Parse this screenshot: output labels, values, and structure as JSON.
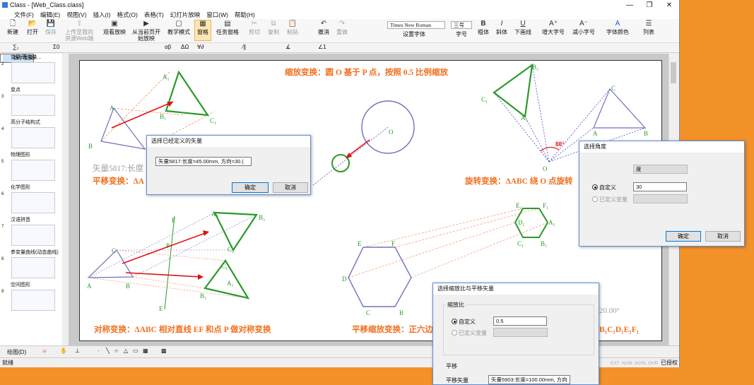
{
  "window": {
    "title": "Class - [Web_Class.class]",
    "controls": [
      "—",
      "❐",
      "✕"
    ]
  },
  "menu": [
    "文件(F)",
    "编辑(E)",
    "视图(V)",
    "插入(I)",
    "格式(O)",
    "表格(T)",
    "幻灯片放映",
    "窗口(W)",
    "帮助(H)"
  ],
  "ribbon": {
    "new": "新建",
    "open": "打开",
    "save": "保存",
    "upload_1": "上传至我的",
    "upload_2": "资源Web端",
    "watch_show": "观看放映",
    "from_page_1": "从当前页开",
    "from_page_2": "始放映",
    "teach_mode": "教学模式",
    "window_btn": "窗格",
    "task_pane": "任务窗格",
    "cut": "剪切",
    "copy": "复制",
    "paste": "粘贴",
    "undo": "撤消",
    "redo": "重做",
    "font_name": "Times New Roman",
    "font_size": "三号",
    "set_font": "设置字体",
    "size_label": "字号",
    "bold": "粗体",
    "italic": "斜体",
    "underline": "下画线",
    "grow_font": "增大字号",
    "shrink_font": "减小字号",
    "font_color": "字体颜色",
    "list": "列表"
  },
  "toolbar2": [
    "∑₁",
    "Σ0",
    "αβ",
    "ΔΩ",
    "∀∂",
    "∕∥",
    "∡",
    "∠1"
  ],
  "sidebar": [
    {
      "label": "数学变换",
      "num": "1"
    },
    {
      "label": "变量-真变量...",
      "num": "2"
    },
    {
      "label": "变点",
      "num": "3"
    },
    {
      "label": "高分子结构式",
      "num": "4"
    },
    {
      "label": "物理图形",
      "num": "5"
    },
    {
      "label": "化学图形",
      "num": "6"
    },
    {
      "label": "汉语拼音",
      "num": "7"
    },
    {
      "label": "参变量曲线(动态曲线)",
      "num": "8"
    },
    {
      "label": "空间图形",
      "num": "9"
    }
  ],
  "slide": {
    "scale_title": "缩放变换：圆 O 基于 P 点，按照 0.5 比例缩放",
    "vector_text": "矢量5817:长度",
    "translate_title": "平移变换：ΔA",
    "rotate_title": "旋转变换：ΔABC 绕 O 点旋转",
    "angle_label": "80°",
    "symmetry_title": "对称变换：ΔABC 相对直线 EF 和点 P 做对称变换",
    "transscale_title": "平移缩放变换：正六边",
    "transscale_tail": "B₁C₁D₁E₁F₁",
    "angle_tail": "20.00°",
    "labels": {
      "A": "A",
      "B": "B",
      "C": "C",
      "A1": "A₁",
      "B1": "B₁",
      "C1": "C₁",
      "A2": "A₂",
      "B2": "B₂",
      "C2": "C₂",
      "D": "D",
      "E": "E",
      "F": "F",
      "D1": "D₁",
      "E1": "E₁",
      "F1": "F₁",
      "O": "O",
      "P": "P"
    }
  },
  "dialog_vector": {
    "title": "选择已经定义的矢量",
    "selected": "矢量5817:长度=45.00mm, 方向=30.(",
    "ok": "确定",
    "cancel": "取消"
  },
  "dialog_angle": {
    "title": "选择角度",
    "unit_label": "单位",
    "unit_value": "度",
    "custom": "自定义",
    "custom_value": "30",
    "defined_var": "已定义变量",
    "ok": "确定",
    "cancel": "取消"
  },
  "dialog_scale": {
    "title": "选择缩放比与平移矢量",
    "group_scale": "缩放比",
    "custom": "自定义",
    "custom_value": "0.5",
    "defined_var": "已定义变量",
    "group_translate": "平移",
    "translate_label": "平移矢量",
    "translate_value": "矢量5903:长度=100.00mm, 方向"
  },
  "bottombar": {
    "draw": "绘图(D)"
  },
  "status": {
    "ready": "就绪",
    "indicators": [
      "EXT",
      "NUM",
      "SCRL",
      "OVR"
    ],
    "auth": "已授权"
  }
}
